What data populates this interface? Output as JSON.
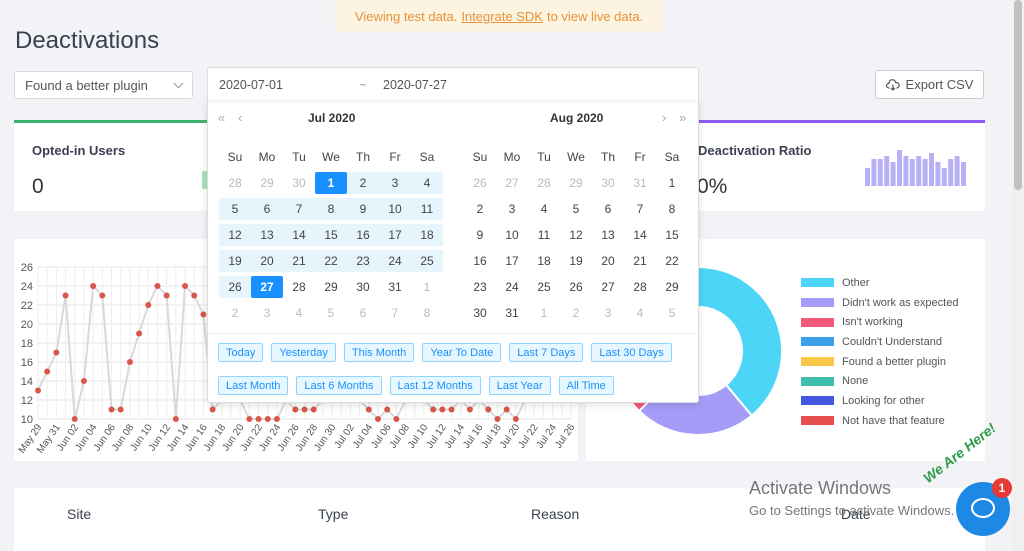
{
  "banner": {
    "prefix": "Viewing test data.",
    "link": "Integrate SDK",
    "suffix": "to view live data."
  },
  "page_title": "Deactivations",
  "reason_filter": {
    "value": "Found a better plugin"
  },
  "date_range": {
    "start": "2020-07-01",
    "separator": "~",
    "end": "2020-07-27"
  },
  "export_label": "Export CSV",
  "stats": {
    "opted_in": {
      "label": "Opted-in Users",
      "value": "0"
    },
    "ratio": {
      "label": "Deactivation Ratio",
      "value": "0%"
    }
  },
  "picker": {
    "nav": {
      "prev_year": "«",
      "prev_month": "‹",
      "next_month": "›",
      "next_year": "»"
    },
    "left": {
      "title": "Jul 2020",
      "weekdays": [
        "Su",
        "Mo",
        "Tu",
        "We",
        "Th",
        "Fr",
        "Sa"
      ],
      "weeks": [
        [
          {
            "d": "28",
            "s": "out"
          },
          {
            "d": "29",
            "s": "out"
          },
          {
            "d": "30",
            "s": "out"
          },
          {
            "d": "1",
            "s": "sel"
          },
          {
            "d": "2",
            "s": "range"
          },
          {
            "d": "3",
            "s": "range"
          },
          {
            "d": "4",
            "s": "range"
          }
        ],
        [
          {
            "d": "5",
            "s": "range"
          },
          {
            "d": "6",
            "s": "range"
          },
          {
            "d": "7",
            "s": "range"
          },
          {
            "d": "8",
            "s": "range"
          },
          {
            "d": "9",
            "s": "range"
          },
          {
            "d": "10",
            "s": "range"
          },
          {
            "d": "11",
            "s": "range"
          }
        ],
        [
          {
            "d": "12",
            "s": "range"
          },
          {
            "d": "13",
            "s": "range"
          },
          {
            "d": "14",
            "s": "range"
          },
          {
            "d": "15",
            "s": "range"
          },
          {
            "d": "16",
            "s": "range"
          },
          {
            "d": "17",
            "s": "range"
          },
          {
            "d": "18",
            "s": "range"
          }
        ],
        [
          {
            "d": "19",
            "s": "range"
          },
          {
            "d": "20",
            "s": "range"
          },
          {
            "d": "21",
            "s": "range"
          },
          {
            "d": "22",
            "s": "range"
          },
          {
            "d": "23",
            "s": "range"
          },
          {
            "d": "24",
            "s": "range"
          },
          {
            "d": "25",
            "s": "range"
          }
        ],
        [
          {
            "d": "26",
            "s": "range"
          },
          {
            "d": "27",
            "s": "sel"
          },
          {
            "d": "28",
            "s": ""
          },
          {
            "d": "29",
            "s": ""
          },
          {
            "d": "30",
            "s": ""
          },
          {
            "d": "31",
            "s": ""
          },
          {
            "d": "1",
            "s": "out"
          }
        ],
        [
          {
            "d": "2",
            "s": "out"
          },
          {
            "d": "3",
            "s": "out"
          },
          {
            "d": "4",
            "s": "out"
          },
          {
            "d": "5",
            "s": "out"
          },
          {
            "d": "6",
            "s": "out"
          },
          {
            "d": "7",
            "s": "out"
          },
          {
            "d": "8",
            "s": "out"
          }
        ]
      ]
    },
    "right": {
      "title": "Aug 2020",
      "weekdays": [
        "Su",
        "Mo",
        "Tu",
        "We",
        "Th",
        "Fr",
        "Sa"
      ],
      "weeks": [
        [
          {
            "d": "26",
            "s": "out"
          },
          {
            "d": "27",
            "s": "out"
          },
          {
            "d": "28",
            "s": "out"
          },
          {
            "d": "29",
            "s": "out"
          },
          {
            "d": "30",
            "s": "out"
          },
          {
            "d": "31",
            "s": "out"
          },
          {
            "d": "1",
            "s": ""
          }
        ],
        [
          {
            "d": "2",
            "s": ""
          },
          {
            "d": "3",
            "s": ""
          },
          {
            "d": "4",
            "s": ""
          },
          {
            "d": "5",
            "s": ""
          },
          {
            "d": "6",
            "s": ""
          },
          {
            "d": "7",
            "s": ""
          },
          {
            "d": "8",
            "s": ""
          }
        ],
        [
          {
            "d": "9",
            "s": ""
          },
          {
            "d": "10",
            "s": ""
          },
          {
            "d": "11",
            "s": ""
          },
          {
            "d": "12",
            "s": ""
          },
          {
            "d": "13",
            "s": ""
          },
          {
            "d": "14",
            "s": ""
          },
          {
            "d": "15",
            "s": ""
          }
        ],
        [
          {
            "d": "16",
            "s": ""
          },
          {
            "d": "17",
            "s": ""
          },
          {
            "d": "18",
            "s": ""
          },
          {
            "d": "19",
            "s": ""
          },
          {
            "d": "20",
            "s": ""
          },
          {
            "d": "21",
            "s": ""
          },
          {
            "d": "22",
            "s": ""
          }
        ],
        [
          {
            "d": "23",
            "s": ""
          },
          {
            "d": "24",
            "s": ""
          },
          {
            "d": "25",
            "s": ""
          },
          {
            "d": "26",
            "s": ""
          },
          {
            "d": "27",
            "s": ""
          },
          {
            "d": "28",
            "s": ""
          },
          {
            "d": "29",
            "s": ""
          }
        ],
        [
          {
            "d": "30",
            "s": ""
          },
          {
            "d": "31",
            "s": ""
          },
          {
            "d": "1",
            "s": "out"
          },
          {
            "d": "2",
            "s": "out"
          },
          {
            "d": "3",
            "s": "out"
          },
          {
            "d": "4",
            "s": "out"
          },
          {
            "d": "5",
            "s": "out"
          }
        ]
      ]
    },
    "presets": [
      "Today",
      "Yesterday",
      "This Month",
      "Year To Date",
      "Last 7 Days",
      "Last 30 Days",
      "Last Month",
      "Last 6 Months",
      "Last 12 Months",
      "Last Year",
      "All Time"
    ]
  },
  "chart_data": [
    {
      "type": "line",
      "ylim": [
        10,
        26
      ],
      "yticks": [
        "10",
        "12",
        "14",
        "16",
        "18",
        "20",
        "22",
        "24",
        "26"
      ],
      "x": [
        "May 29",
        "May 30",
        "May 31",
        "Jun 01",
        "Jun 02",
        "Jun 03",
        "Jun 04",
        "Jun 05",
        "Jun 06",
        "Jun 07",
        "Jun 08",
        "Jun 09",
        "Jun 10",
        "Jun 11",
        "Jun 12",
        "Jun 13",
        "Jun 14",
        "Jun 15",
        "Jun 16",
        "Jun 17",
        "Jun 18",
        "Jun 19",
        "Jun 20",
        "Jun 21",
        "Jun 22",
        "Jun 23",
        "Jun 24",
        "Jun 25",
        "Jun 26",
        "Jun 27",
        "Jun 28",
        "Jun 29",
        "Jun 30",
        "Jul 01",
        "Jul 02",
        "Jul 03",
        "Jul 04",
        "Jul 05",
        "Jul 06",
        "Jul 07",
        "Jul 08",
        "Jul 09",
        "Jul 10",
        "Jul 11",
        "Jul 12",
        "Jul 13",
        "Jul 14",
        "Jul 15",
        "Jul 16",
        "Jul 17",
        "Jul 18",
        "Jul 19",
        "Jul 20",
        "Jul 21",
        "Jul 22",
        "Jul 23",
        "Jul 24",
        "Jul 25",
        "Jul 26"
      ],
      "xtick_labels": [
        "May 29",
        "May 31",
        "Jun 02",
        "Jun 04",
        "Jun 06",
        "Jun 08",
        "Jun 10",
        "Jun 12",
        "Jun 14",
        "Jun 16",
        "Jun 18",
        "Jun 20",
        "Jun 22",
        "Jun 24",
        "Jun 26",
        "Jun 28",
        "Jun 30",
        "Jul 02",
        "Jul 04",
        "Jul 06",
        "Jul 08",
        "Jul 10",
        "Jul 12",
        "Jul 14",
        "Jul 16",
        "Jul 18",
        "Jul 20",
        "Jul 22",
        "Jul 24",
        "Jul 26"
      ],
      "series": [
        {
          "values": [
            13,
            15,
            17,
            23,
            10,
            14,
            24,
            23,
            11,
            11,
            16,
            19,
            22,
            24,
            23,
            10,
            24,
            23,
            21,
            11,
            12,
            12,
            12,
            10,
            10,
            10,
            10,
            12,
            11,
            11,
            11,
            12,
            12,
            12,
            12,
            12,
            11,
            10,
            11,
            10,
            12,
            12,
            12,
            11,
            11,
            11,
            12,
            11,
            12,
            11,
            10,
            11,
            10,
            12,
            12,
            12,
            12,
            12,
            12
          ]
        }
      ],
      "line_color": "#d9d9d9",
      "point_color": "#d9574a"
    },
    {
      "type": "pie",
      "donut": true,
      "labels": [
        "Other",
        "Didn't work as expected",
        "Isn't working",
        "Couldn't Understand",
        "Found a better plugin",
        "None",
        "Looking for other",
        "Not have that feature"
      ],
      "values": [
        30,
        18,
        15,
        14,
        0,
        0,
        0,
        0
      ],
      "colors": [
        "#4dd5f7",
        "#a59cf7",
        "#f5597a",
        "#3aa0e8",
        "#f8c948",
        "#40bfae",
        "#4258e0",
        "#e64e4e"
      ]
    },
    {
      "type": "bar",
      "values": [
        6,
        9,
        9,
        10,
        8,
        12,
        10,
        9,
        10,
        9,
        11,
        8,
        6,
        9,
        10,
        8
      ],
      "color": "#b8b0f5"
    }
  ],
  "table": {
    "headers": [
      "Site",
      "Type",
      "Reason",
      "Date"
    ]
  },
  "watermark": {
    "line1": "Activate Windows",
    "line2": "Go to Settings to activate Windows."
  },
  "chat": {
    "badge": "1",
    "tagline": "We Are Here!"
  },
  "colors": {
    "accent": "#1890ff",
    "green": "#3cb371",
    "purple": "#8b5cf6",
    "banner_text": "#e8923a"
  }
}
